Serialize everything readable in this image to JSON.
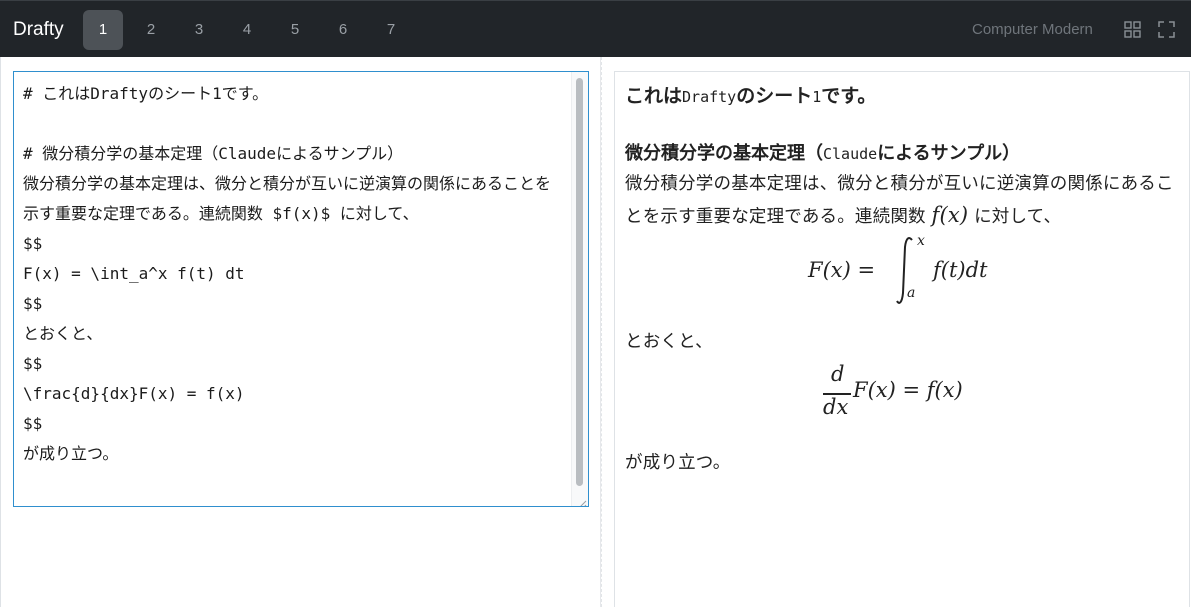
{
  "app": {
    "brand": "Drafty",
    "tabs": [
      "1",
      "2",
      "3",
      "4",
      "5",
      "6",
      "7"
    ],
    "active_tab": "1",
    "font_name": "Computer Modern",
    "icons": [
      "grid-icon",
      "fullscreen-icon"
    ]
  },
  "editor": {
    "lines": [
      "# これはDraftyのシート1です。",
      "",
      "# 微分積分学の基本定理（Claudeによるサンプル）",
      "微分積分学の基本定理は、微分と積分が互いに逆演算の関係にあることを示す重要な定理である。連続関数 $f(x)$ に対して、",
      "$$",
      "F(x) = \\int_a^x f(t) dt",
      "$$",
      "とおくと、",
      "$$",
      "\\frac{d}{dx}F(x) = f(x)",
      "$$",
      "が成り立つ。"
    ]
  },
  "preview": {
    "h1_pre": "これは",
    "h1_code": "Drafty",
    "h1_post": "のシート",
    "h1_num": "1",
    "h1_end": "です。",
    "h2_pre": "微分積分学の基本定理（",
    "h2_code": "Claude",
    "h2_post": "によるサンプル）",
    "p1_text": "微分積分学の基本定理は、微分と積分が互いに逆演算の関係にあることを示す重要な定理である。連続関数",
    "p1_math": "f(x)",
    "p1_after": "に対して、",
    "eq1": {
      "lhs": "F(x) =",
      "upper": "x",
      "lower": "a",
      "integrand": "f(t)dt"
    },
    "p2": "とおくと、",
    "eq2": {
      "num": "d",
      "den": "dx",
      "rest": "F(x) = f(x)"
    },
    "p3": "が成り立つ。"
  },
  "colors": {
    "topbar": "#212529",
    "active_tab": "#4d5257",
    "editor_border": "#2f8fce"
  }
}
